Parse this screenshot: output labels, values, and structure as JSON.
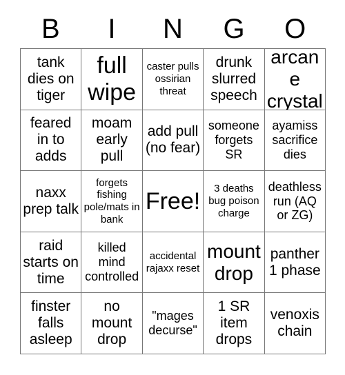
{
  "card": {
    "headers": [
      "B",
      "I",
      "N",
      "G",
      "O"
    ],
    "rows": [
      [
        {
          "text": "tank dies on tiger",
          "size": "l"
        },
        {
          "text": "full wipe",
          "size": "xxl"
        },
        {
          "text": "caster pulls ossirian threat",
          "size": "s"
        },
        {
          "text": "drunk slurred speech",
          "size": "l"
        },
        {
          "text": "arcane crystal",
          "size": "xl"
        }
      ],
      [
        {
          "text": "feared in to adds",
          "size": "l"
        },
        {
          "text": "moam early pull",
          "size": "l"
        },
        {
          "text": "add pull (no fear)",
          "size": "l"
        },
        {
          "text": "someone forgets SR",
          "size": "m"
        },
        {
          "text": "ayamiss sacrifice dies",
          "size": "m"
        }
      ],
      [
        {
          "text": "naxx prep talk",
          "size": "l"
        },
        {
          "text": "forgets fishing pole/mats in bank",
          "size": "s"
        },
        {
          "text": "Free!",
          "size": "free"
        },
        {
          "text": "3 deaths bug poison charge",
          "size": "s"
        },
        {
          "text": "deathless run (AQ or ZG)",
          "size": "m"
        }
      ],
      [
        {
          "text": "raid starts on time",
          "size": "l"
        },
        {
          "text": "killed mind controlled",
          "size": "m"
        },
        {
          "text": "accidental rajaxx reset",
          "size": "s"
        },
        {
          "text": "mount drop",
          "size": "xl"
        },
        {
          "text": "panther 1 phase",
          "size": "l"
        }
      ],
      [
        {
          "text": "finster falls asleep",
          "size": "l"
        },
        {
          "text": "no mount drop",
          "size": "l"
        },
        {
          "text": "\"mages decurse\"",
          "size": "m"
        },
        {
          "text": "1 SR item drops",
          "size": "l"
        },
        {
          "text": "venoxis chain",
          "size": "l"
        }
      ]
    ]
  },
  "colors": {
    "border": "#777777",
    "text": "#000000",
    "background": "#ffffff"
  }
}
